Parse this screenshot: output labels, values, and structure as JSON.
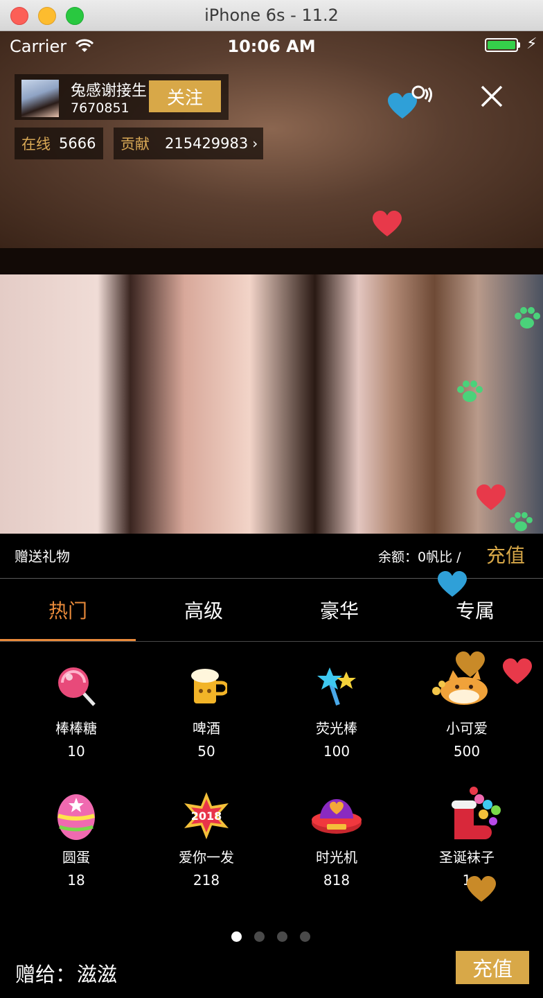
{
  "window": {
    "title": "iPhone 6s - 11.2"
  },
  "status_bar": {
    "carrier": "Carrier",
    "time": "10:06 AM",
    "charging": true
  },
  "host": {
    "name": "兔感谢接生",
    "id": "7670851",
    "follow_label": "关注"
  },
  "stats": {
    "online_label": "在线",
    "online_value": "5666",
    "contribution_label": "贡献",
    "contribution_value": "215429983",
    "contribution_arrow": "›"
  },
  "gift_panel": {
    "title": "赠送礼物",
    "balance_text": "余额：0帆比 /",
    "recharge_link": "充值",
    "tabs": [
      {
        "label": "热门",
        "active": true
      },
      {
        "label": "高级",
        "active": false
      },
      {
        "label": "豪华",
        "active": false
      },
      {
        "label": "专属",
        "active": false
      }
    ],
    "gifts": [
      {
        "name": "棒棒糖",
        "price": "10",
        "icon": "lollipop-icon"
      },
      {
        "name": "啤酒",
        "price": "50",
        "icon": "beer-icon"
      },
      {
        "name": "荧光棒",
        "price": "100",
        "icon": "glowstick-icon"
      },
      {
        "name": "小可爱",
        "price": "500",
        "icon": "cute-pet-icon"
      },
      {
        "name": "圆蛋",
        "price": "18",
        "icon": "egg-icon"
      },
      {
        "name": "爱你一发",
        "price": "218",
        "icon": "2018-badge-icon"
      },
      {
        "name": "时光机",
        "price": "818",
        "icon": "time-machine-icon"
      },
      {
        "name": "圣诞袜子",
        "price": "1",
        "icon": "christmas-stocking-icon"
      }
    ],
    "page_count": 4,
    "current_page": 1,
    "send_to_label": "赠给：",
    "send_to_name": "滋滋",
    "recharge_button": "充值"
  },
  "colors": {
    "accent_gold": "#d8a848",
    "tab_active": "#e98a3a",
    "background": "#000000"
  }
}
